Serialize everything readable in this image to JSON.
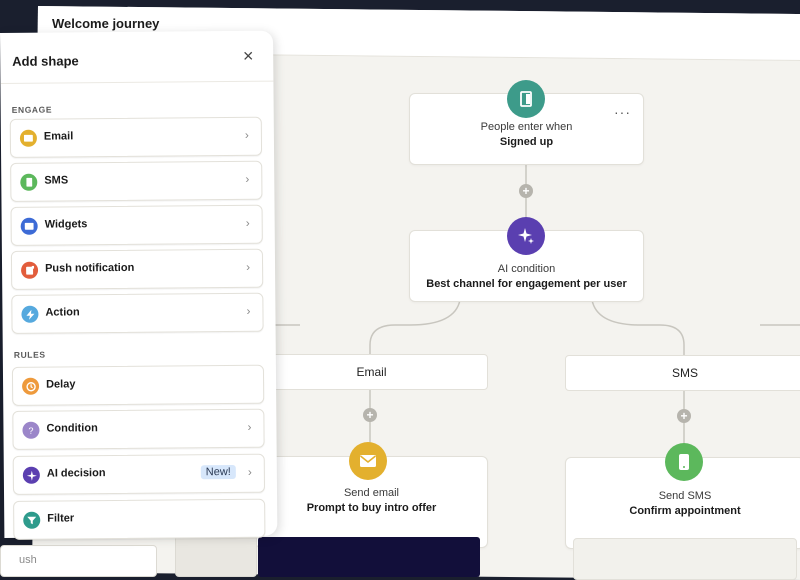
{
  "journey": {
    "title": "Welcome journey"
  },
  "panel": {
    "title": "Add shape",
    "engage_label": "ENGAGE",
    "rules_label": "RULES",
    "engage_items": [
      {
        "label": "Email",
        "icon": "email-icon",
        "color": "#e3b02e"
      },
      {
        "label": "SMS",
        "icon": "sms-icon",
        "color": "#5cb85c"
      },
      {
        "label": "Widgets",
        "icon": "widgets-icon",
        "color": "#3d6bd6"
      },
      {
        "label": "Push notification",
        "icon": "push-notification-icon",
        "color": "#e25d3c"
      },
      {
        "label": "Action",
        "icon": "lightning-icon",
        "color": "#56a9de"
      }
    ],
    "rules_items": [
      {
        "label": "Delay",
        "icon": "clock-icon",
        "color": "#ee9a3c"
      },
      {
        "label": "Condition",
        "icon": "question-icon",
        "color": "#9b86c9"
      },
      {
        "label": "AI decision",
        "icon": "sparkle-icon",
        "color": "#5b3fb0",
        "badge": "New!"
      },
      {
        "label": "Filter",
        "icon": "filter-icon",
        "color": "#2e9b8c"
      }
    ]
  },
  "flow": {
    "trigger": {
      "sub": "People enter when",
      "main": "Signed up",
      "icon": "door-enter-icon",
      "color": "#3d9b8a"
    },
    "ai_condition": {
      "sub": "AI condition",
      "main": "Best channel for engagement per user",
      "icon": "sparkle-icon",
      "color": "#5a3fb0"
    },
    "branches": [
      "Email",
      "SMS"
    ],
    "send_email": {
      "sub": "Send email",
      "main": "Prompt to buy intro offer",
      "icon": "envelope-icon",
      "color": "#e3b02e"
    },
    "send_sms": {
      "sub": "Send SMS",
      "main": "Confirm appointment",
      "icon": "phone-icon",
      "color": "#5cb85c"
    },
    "bottom_partial": "ush"
  }
}
